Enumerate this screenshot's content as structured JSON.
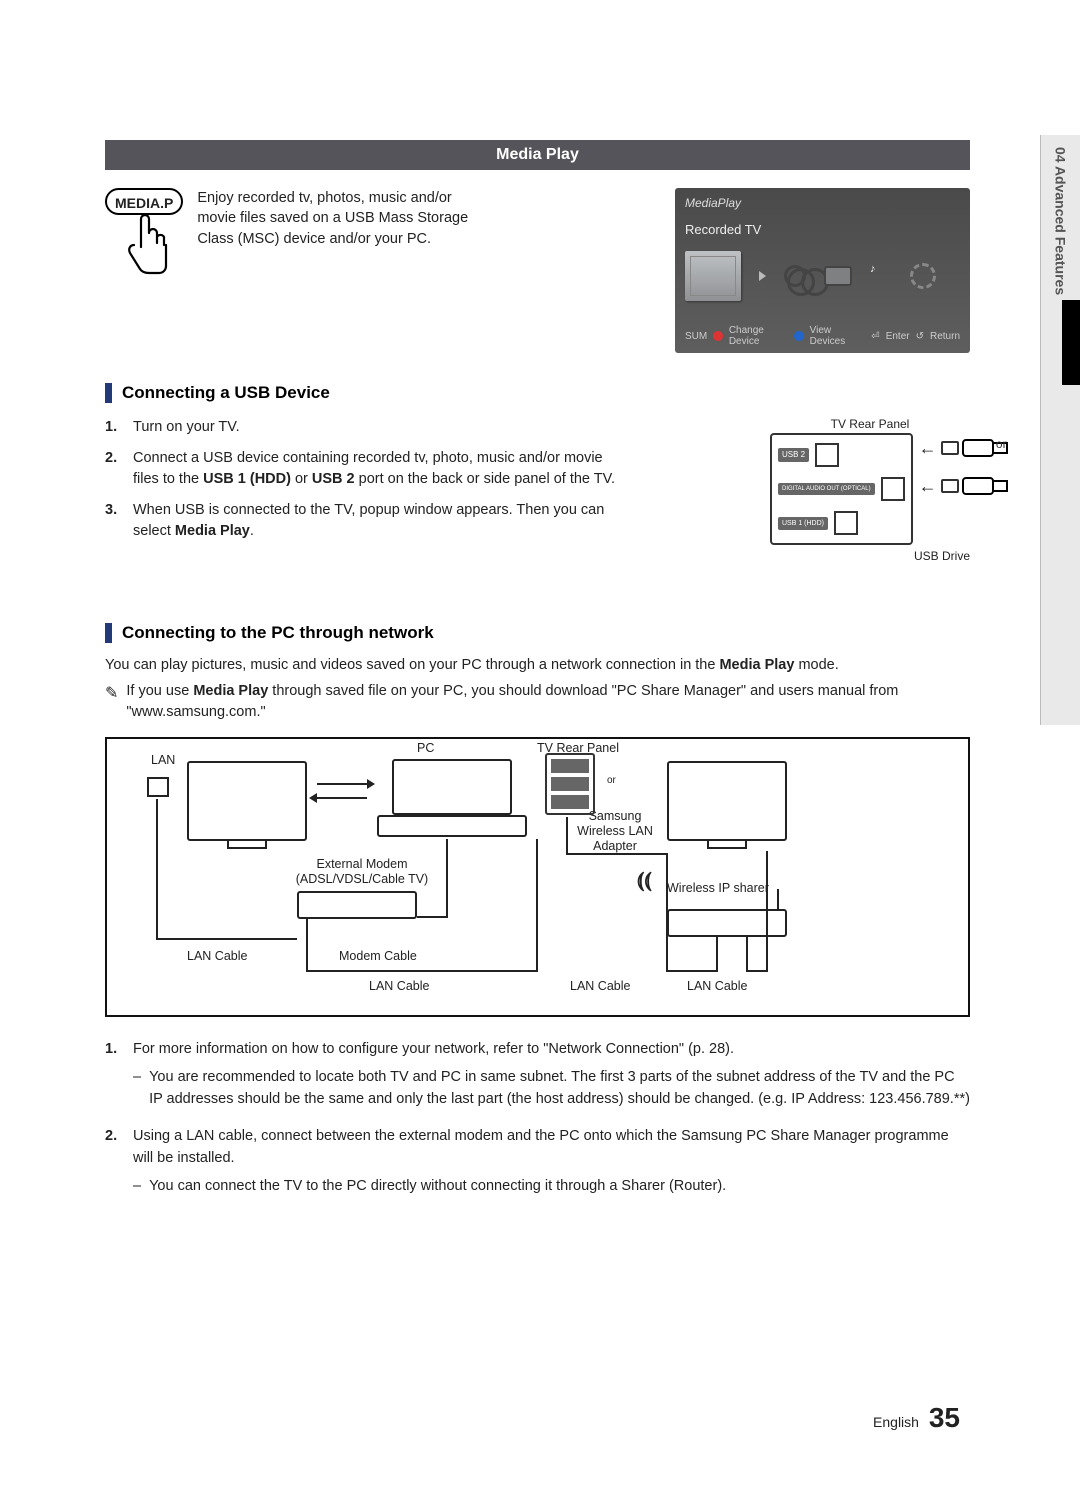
{
  "sideTab": {
    "text": "04  Advanced Features"
  },
  "banner": {
    "title": "Media Play"
  },
  "mediaButton": {
    "label": "MEDIA.P"
  },
  "intro": "Enjoy recorded tv, photos, music and/or movie files saved on a USB Mass Storage Class (MSC) device and/or your PC.",
  "tvUi": {
    "title": "MediaPlay",
    "subtitle": "Recorded TV",
    "footer": {
      "sum": "SUM",
      "changeDevice": "Change Device",
      "viewDevices": "View Devices",
      "enter": "Enter",
      "return": "Return"
    }
  },
  "section1": {
    "heading": "Connecting a USB Device",
    "steps": [
      {
        "num": "1.",
        "text": "Turn on your TV."
      },
      {
        "num": "2.",
        "prefix": "Connect a USB device containing recorded tv, photo, music and/or movie files to the ",
        "b1": "USB 1 (HDD)",
        "mid": " or ",
        "b2": "USB 2",
        "suffix": " port on the back or side panel of the TV."
      },
      {
        "num": "3.",
        "prefix": "When USB is connected to the TV, popup window appears. Then you can select ",
        "b1": "Media Play",
        "suffix": "."
      }
    ],
    "rearPanel": {
      "title": "TV Rear Panel",
      "port1": "USB 2",
      "port2": "DIGITAL AUDIO OUT (OPTICAL)",
      "port3": "USB 1 (HDD)",
      "or": "or",
      "drive": "USB Drive"
    }
  },
  "section2": {
    "heading": "Connecting to the PC through network",
    "intro_prefix": "You can play pictures, music and videos saved on your PC through a network connection in the ",
    "intro_bold": "Media Play",
    "intro_suffix": " mode.",
    "note_prefix": "If you use ",
    "note_bold": "Media Play",
    "note_suffix": " through saved file on your PC, you should download \"PC Share Manager\" and users manual from \"www.samsung.com.\"",
    "diagram": {
      "lan": "LAN",
      "pc": "PC",
      "rear": "TV Rear Panel",
      "or": "or",
      "samsung": "Samsung Wireless LAN Adapter",
      "modem": "External Modem\n(ADSL/VDSL/Cable TV)",
      "sharer": "Wireless IP sharer",
      "lanCable": "LAN Cable",
      "modemCable": "Modem Cable"
    },
    "afterSteps": [
      {
        "num": "1.",
        "text": "For more information on how to configure your network, refer to \"Network Connection\" (p. 28).",
        "subs": [
          "You are recommended to locate both TV and PC in same subnet. The first 3 parts of the subnet address of the TV and the PC IP addresses should be the same and only the last part (the host address) should be changed. (e.g. IP Address: 123.456.789.**)"
        ]
      },
      {
        "num": "2.",
        "text": "Using a LAN cable, connect between the external modem and the PC onto which the Samsung PC Share Manager programme will be installed.",
        "subs": [
          "You can connect the TV to the PC directly without connecting it through a Sharer (Router)."
        ]
      }
    ]
  },
  "footer": {
    "lang": "English",
    "page": "35"
  }
}
